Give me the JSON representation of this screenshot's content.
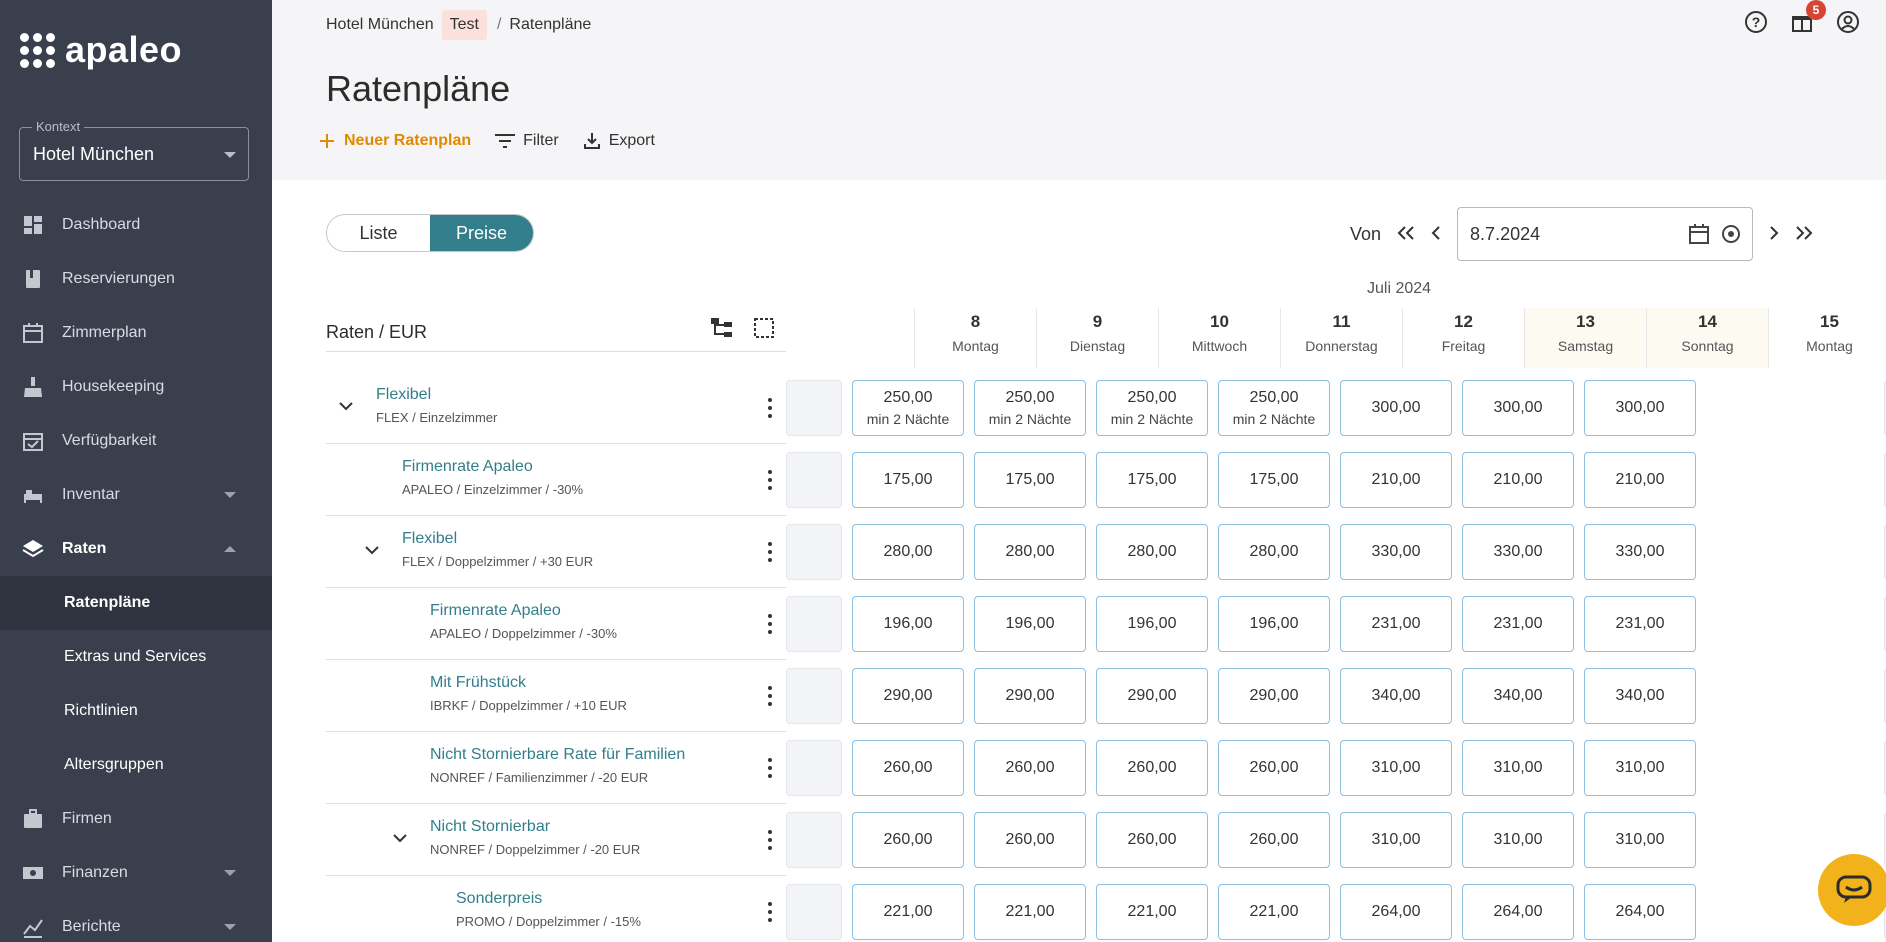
{
  "logo": {
    "text": "apaleo"
  },
  "context": {
    "label": "Kontext",
    "value": "Hotel München"
  },
  "nav": [
    {
      "label": "Dashboard",
      "icon": "dashboard-icon",
      "caret": ""
    },
    {
      "label": "Reservierungen",
      "icon": "book-icon",
      "caret": ""
    },
    {
      "label": "Zimmerplan",
      "icon": "calendar-icon",
      "caret": ""
    },
    {
      "label": "Housekeeping",
      "icon": "housekeeping-icon",
      "caret": ""
    },
    {
      "label": "Verfügbarkeit",
      "icon": "calendar-check-icon",
      "caret": ""
    },
    {
      "label": "Inventar",
      "icon": "bed-icon",
      "caret": "down"
    },
    {
      "label": "Raten",
      "icon": "layers-icon",
      "caret": "up",
      "active": true
    }
  ],
  "subnav": [
    {
      "label": "Ratenpläne",
      "selected": true
    },
    {
      "label": "Extras und Services"
    },
    {
      "label": "Richtlinien"
    },
    {
      "label": "Altersgruppen"
    }
  ],
  "nav_bottom": [
    {
      "label": "Firmen",
      "icon": "briefcase-icon",
      "caret": ""
    },
    {
      "label": "Finanzen",
      "icon": "money-icon",
      "caret": "down"
    },
    {
      "label": "Berichte",
      "icon": "chart-icon",
      "caret": "down"
    }
  ],
  "breadcrumb": {
    "hotel": "Hotel München",
    "tag": "Test",
    "sep": "/",
    "current": "Ratenpläne"
  },
  "header": {
    "badge_count": "5"
  },
  "page": {
    "title": "Ratenpläne"
  },
  "actions": {
    "new": "Neuer Ratenplan",
    "filter": "Filter",
    "export": "Export"
  },
  "view_toggle": {
    "list": "Liste",
    "prices": "Preise"
  },
  "date": {
    "from_label": "Von",
    "value": "8.7.2024"
  },
  "calendar": {
    "month": "Juli 2024",
    "rates_header": "Raten / EUR",
    "days": [
      {
        "num": "8",
        "name": "Montag"
      },
      {
        "num": "9",
        "name": "Dienstag"
      },
      {
        "num": "10",
        "name": "Mittwoch"
      },
      {
        "num": "11",
        "name": "Donnerstag"
      },
      {
        "num": "12",
        "name": "Freitag"
      },
      {
        "num": "13",
        "name": "Samstag",
        "weekend": true
      },
      {
        "num": "14",
        "name": "Sonntag",
        "weekend": true
      },
      {
        "num": "15",
        "name": "Montag"
      }
    ]
  },
  "rates": [
    {
      "name": "Flexibel",
      "meta": "FLEX / Einzelzimmer",
      "level": 0,
      "expand": true,
      "prices": [
        "250,00",
        "250,00",
        "250,00",
        "250,00",
        "300,00",
        "300,00",
        "300,00"
      ],
      "notes": [
        "min 2 Nächte",
        "min 2 Nächte",
        "min 2 Nächte",
        "min 2 Nächte",
        "",
        "",
        ""
      ]
    },
    {
      "name": "Firmenrate Apaleo",
      "meta": "APALEO / Einzelzimmer / -30%",
      "level": 1,
      "expand": false,
      "prices": [
        "175,00",
        "175,00",
        "175,00",
        "175,00",
        "210,00",
        "210,00",
        "210,00"
      ]
    },
    {
      "name": "Flexibel",
      "meta": "FLEX / Doppelzimmer / +30 EUR",
      "level": 1,
      "expand": true,
      "prices": [
        "280,00",
        "280,00",
        "280,00",
        "280,00",
        "330,00",
        "330,00",
        "330,00"
      ]
    },
    {
      "name": "Firmenrate Apaleo",
      "meta": "APALEO / Doppelzimmer / -30%",
      "level": 2,
      "expand": false,
      "prices": [
        "196,00",
        "196,00",
        "196,00",
        "196,00",
        "231,00",
        "231,00",
        "231,00"
      ]
    },
    {
      "name": "Mit Frühstück",
      "meta": "IBRKF / Doppelzimmer / +10 EUR",
      "level": 2,
      "expand": false,
      "prices": [
        "290,00",
        "290,00",
        "290,00",
        "290,00",
        "340,00",
        "340,00",
        "340,00"
      ]
    },
    {
      "name": "Nicht Stornierbare Rate für Familien",
      "meta": "NONREF / Familienzimmer / -20 EUR",
      "level": 2,
      "expand": false,
      "prices": [
        "260,00",
        "260,00",
        "260,00",
        "260,00",
        "310,00",
        "310,00",
        "310,00"
      ]
    },
    {
      "name": "Nicht Stornierbar",
      "meta": "NONREF / Doppelzimmer / -20 EUR",
      "level": 2,
      "expand": true,
      "prices": [
        "260,00",
        "260,00",
        "260,00",
        "260,00",
        "310,00",
        "310,00",
        "310,00"
      ]
    },
    {
      "name": "Sonderpreis",
      "meta": "PROMO / Doppelzimmer / -15%",
      "level": 3,
      "expand": false,
      "prices": [
        "221,00",
        "221,00",
        "221,00",
        "221,00",
        "264,00",
        "264,00",
        "264,00"
      ]
    }
  ],
  "colors": {
    "sidebar": "#3a3f4e",
    "accent": "#337e8b",
    "primary_action": "#e08a00",
    "chat": "#f2b21c"
  }
}
